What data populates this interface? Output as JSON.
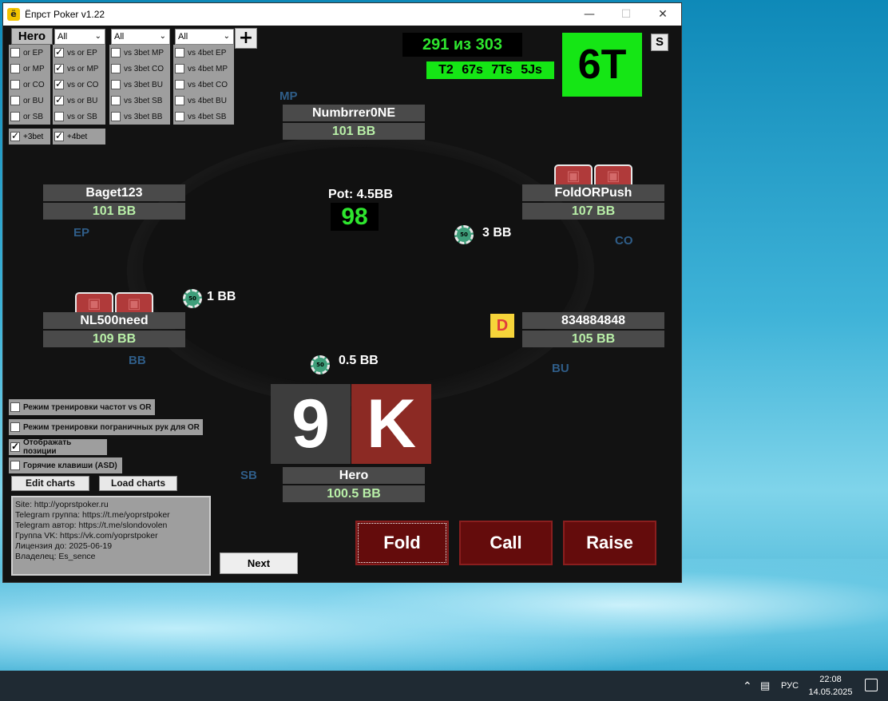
{
  "window": {
    "title": "Ёпрст Poker v1.22",
    "app_icon": "ё"
  },
  "filters": {
    "hero_label": "Hero",
    "selects": [
      "All",
      "All",
      "All",
      "All"
    ],
    "add_label": "+",
    "columns": [
      [
        {
          "label": "or EP",
          "checked": false
        },
        {
          "label": "or MP",
          "checked": false
        },
        {
          "label": "or CO",
          "checked": false
        },
        {
          "label": "or BU",
          "checked": false
        },
        {
          "label": "or SB",
          "checked": false
        }
      ],
      [
        {
          "label": "vs or EP",
          "checked": true
        },
        {
          "label": "vs or MP",
          "checked": true
        },
        {
          "label": "vs or CO",
          "checked": true
        },
        {
          "label": "vs or BU",
          "checked": true
        },
        {
          "label": "vs or SB",
          "checked": false
        }
      ],
      [
        {
          "label": "vs 3bet MP",
          "checked": false
        },
        {
          "label": "vs 3bet CO",
          "checked": false
        },
        {
          "label": "vs 3bet BU",
          "checked": false
        },
        {
          "label": "vs 3bet SB",
          "checked": false
        },
        {
          "label": "vs 3bet BB",
          "checked": false
        }
      ],
      [
        {
          "label": "vs 4bet EP",
          "checked": false
        },
        {
          "label": "vs 4bet MP",
          "checked": false
        },
        {
          "label": "vs 4bet CO",
          "checked": false
        },
        {
          "label": "vs 4bet BU",
          "checked": false
        },
        {
          "label": "vs 4bet SB",
          "checked": false
        }
      ]
    ],
    "bet_options": [
      {
        "label": "+3bet",
        "checked": true
      },
      {
        "label": "+4bet",
        "checked": true
      }
    ]
  },
  "stats": {
    "counter": "291 из 303",
    "hand_range": "T2 67s 7Ts 5Js",
    "current_hand": "6T",
    "s_button": "S"
  },
  "table": {
    "pot": "Pot: 4.5BB",
    "timer": "98",
    "dealer": "D",
    "seats": {
      "mp": {
        "name": "Numbrrer0NE",
        "stack": "101 BB",
        "position": "MP"
      },
      "ep": {
        "name": "Baget123",
        "stack": "101 BB",
        "position": "EP"
      },
      "co": {
        "name": "FoldORPush",
        "stack": "107 BB",
        "position": "CO"
      },
      "bb": {
        "name": "NL500need",
        "stack": "109 BB",
        "position": "BB"
      },
      "bu": {
        "name": "834884848",
        "stack": "105 BB",
        "position": "BU"
      },
      "sb": {
        "name": "Hero",
        "stack": "100.5 BB",
        "position": "SB"
      }
    },
    "bets": {
      "co": "3 BB",
      "bb": "1 BB",
      "sb": "0.5 BB"
    },
    "chip_label": "50",
    "hero_cards": [
      "9",
      "K"
    ],
    "colors": {
      "card1": "#3d3d3d",
      "card2": "#8c2a24",
      "green": "#15e615",
      "action": "#640c0c"
    }
  },
  "modes": [
    {
      "label": "Режим тренировки частот vs OR",
      "checked": false
    },
    {
      "label": "Режим тренировки пограничных рук для OR",
      "checked": false
    },
    {
      "label": "Отображать позиции",
      "checked": true
    },
    {
      "label": "Горячие клавиши (ASD)",
      "checked": false
    }
  ],
  "buttons": {
    "edit_charts": "Edit charts",
    "load_charts": "Load charts",
    "next": "Next",
    "fold": "Fold",
    "call": "Call",
    "raise": "Raise"
  },
  "info": [
    "Site: http://yoprstpoker.ru",
    "Telegram группа: https://t.me/yoprstpoker",
    "Telegram автор: https://t.me/slondovolen",
    "Группа VK: https://vk.com/yoprstpoker",
    "Лицензия до: 2025-06-19",
    "Владелец: Es_sence"
  ],
  "taskbar": {
    "lang": "РУС",
    "time": "22:08",
    "date": "14.05.2025",
    "icons": [
      "chevron-up-icon",
      "network-icon",
      "notification-icon"
    ]
  }
}
